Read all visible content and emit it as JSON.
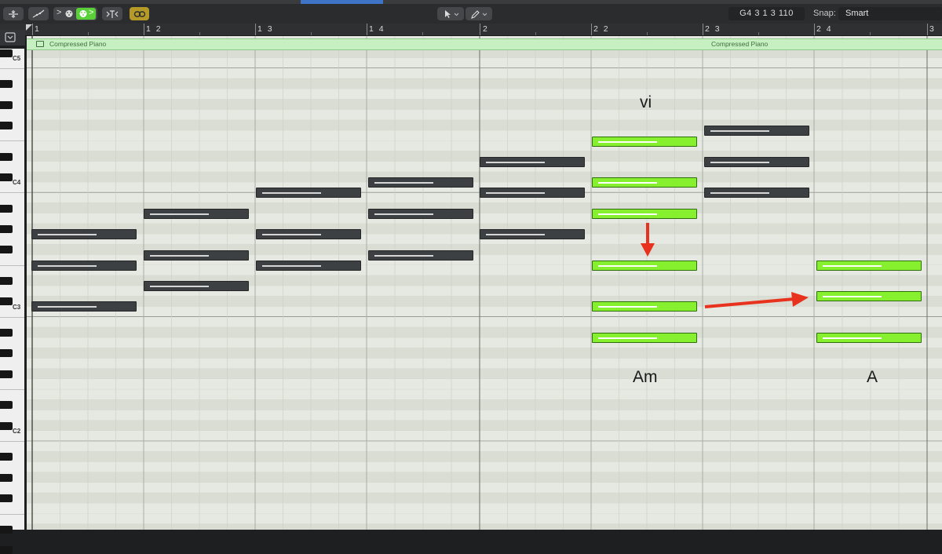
{
  "toolbar": {
    "position": "G4  3 1 3 110",
    "snap_label": "Snap:",
    "snap_value": "Smart",
    "icons": [
      "collapse-icon",
      "automation-curve-icon",
      "midi-in-icon",
      "midi-out-icon",
      "quantize-icon",
      "link-icon",
      "pointer-tool-icon",
      "pencil-tool-icon"
    ]
  },
  "ruler": {
    "marks": [
      "1",
      "1 2",
      "1 3",
      "1 4",
      "2",
      "2 2",
      "2 3",
      "2 4",
      "3"
    ]
  },
  "keyboard": {
    "labels": [
      "C5",
      "C4",
      "C3",
      "C2"
    ]
  },
  "region": {
    "name": "Compressed Piano",
    "name_repeat": "Compressed Piano"
  },
  "annotations": {
    "roman": "vi",
    "chord_am": "Am",
    "chord_a": "A"
  },
  "colors": {
    "note_selected": "#86f02f",
    "note_unselected": "#3d4043",
    "arrow": "#e8321e",
    "region": "#c6f0c2"
  }
}
